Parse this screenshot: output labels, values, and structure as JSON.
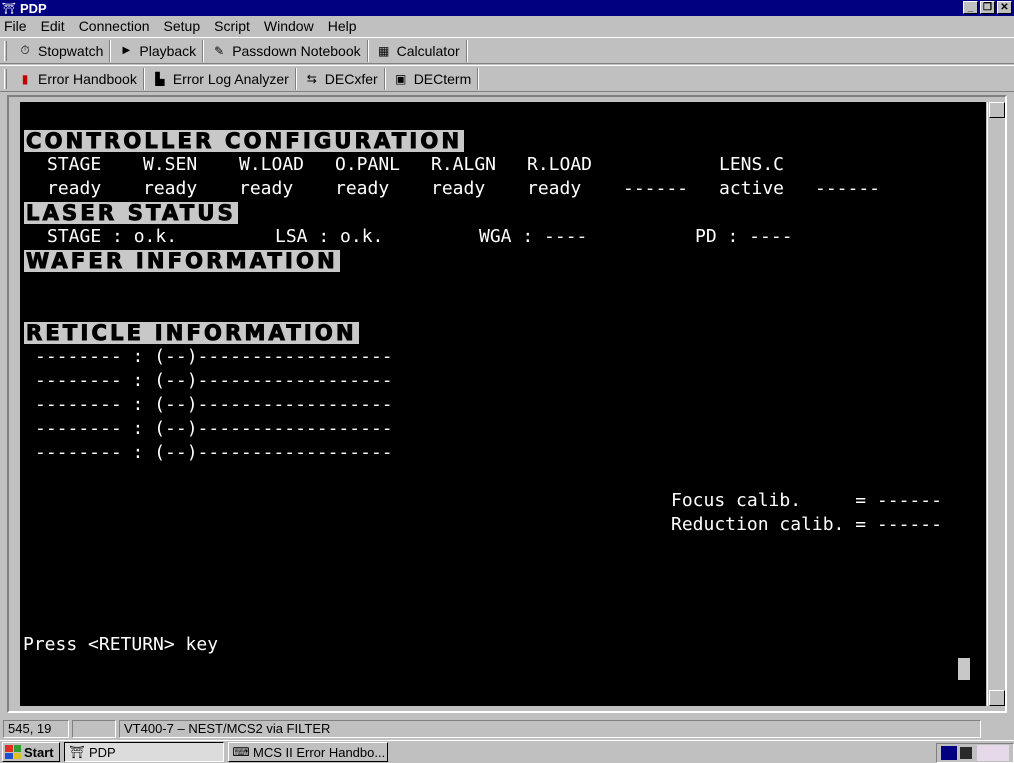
{
  "window": {
    "title": "PDP",
    "minimize": "_",
    "restore": "❐",
    "close": "✕"
  },
  "menu": [
    "File",
    "Edit",
    "Connection",
    "Setup",
    "Script",
    "Window",
    "Help"
  ],
  "toolbar1": [
    {
      "label": "Stopwatch",
      "icon": "stopwatch-icon"
    },
    {
      "label": "Playback",
      "icon": "play-icon"
    },
    {
      "label": "Passdown Notebook",
      "icon": "notebook-pen-icon"
    },
    {
      "label": "Calculator",
      "icon": "calculator-icon"
    }
  ],
  "toolbar2": [
    {
      "label": "Error Handbook",
      "icon": "book-icon"
    },
    {
      "label": "Error Log Analyzer",
      "icon": "bar-chart-icon"
    },
    {
      "label": "DECxfer",
      "icon": "transfer-icon"
    },
    {
      "label": "DECterm",
      "icon": "terminal-icon"
    }
  ],
  "terminal": {
    "controller_header": "CONTROLLER CONFIGURATION",
    "units": [
      "STAGE",
      "W.SEN",
      "W.LOAD",
      "O.PANL",
      "R.ALGN",
      "R.LOAD",
      "",
      "LENS.C",
      ""
    ],
    "states": [
      "ready",
      "ready",
      "ready",
      "ready",
      "ready",
      "ready",
      "------",
      "active",
      "------"
    ],
    "laser_header": "LASER STATUS",
    "laser": {
      "stage": "STAGE : o.k.",
      "lsa": "LSA : o.k.",
      "wga": "WGA : ----",
      "pd": "PD : ----"
    },
    "wafer_header": "WAFER INFORMATION",
    "reticle_header": "RETICLE INFORMATION",
    "reticle_rows": [
      "-------- : (--)------------------",
      "-------- : (--)------------------",
      "-------- : (--)------------------",
      "-------- : (--)------------------",
      "-------- : (--)------------------"
    ],
    "focus_calib": "Focus calib.     = ------",
    "reduction_calib": "Reduction calib. = ------",
    "prompt": "Press <RETURN> key"
  },
  "status": {
    "position": "545, 19",
    "blank": "",
    "connection": "VT400-7 – NEST/MCS2 via FILTER"
  },
  "taskbar": {
    "start": "Start",
    "tasks": [
      {
        "label": "PDP",
        "active": true
      },
      {
        "label": "MCS II Error Handbo...",
        "active": false
      }
    ]
  }
}
